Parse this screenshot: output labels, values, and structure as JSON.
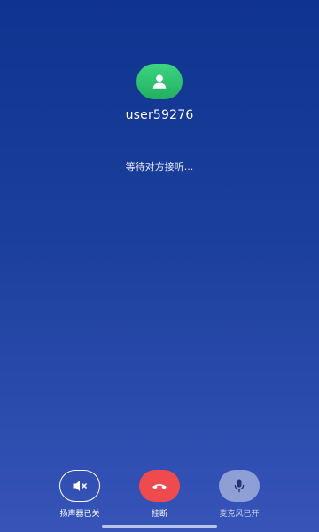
{
  "call": {
    "username": "user59276",
    "status": "等待对方接听..."
  },
  "avatar": {
    "icon": "user-icon",
    "color": "#2bbf6c"
  },
  "controls": {
    "speaker": {
      "label": "扬声器已关",
      "icon": "speaker-muted-icon"
    },
    "hangup": {
      "label": "挂断",
      "icon": "phone-hangup-icon",
      "color": "#ef4b4f"
    },
    "mic": {
      "label": "麦克风已开",
      "icon": "microphone-icon"
    }
  }
}
